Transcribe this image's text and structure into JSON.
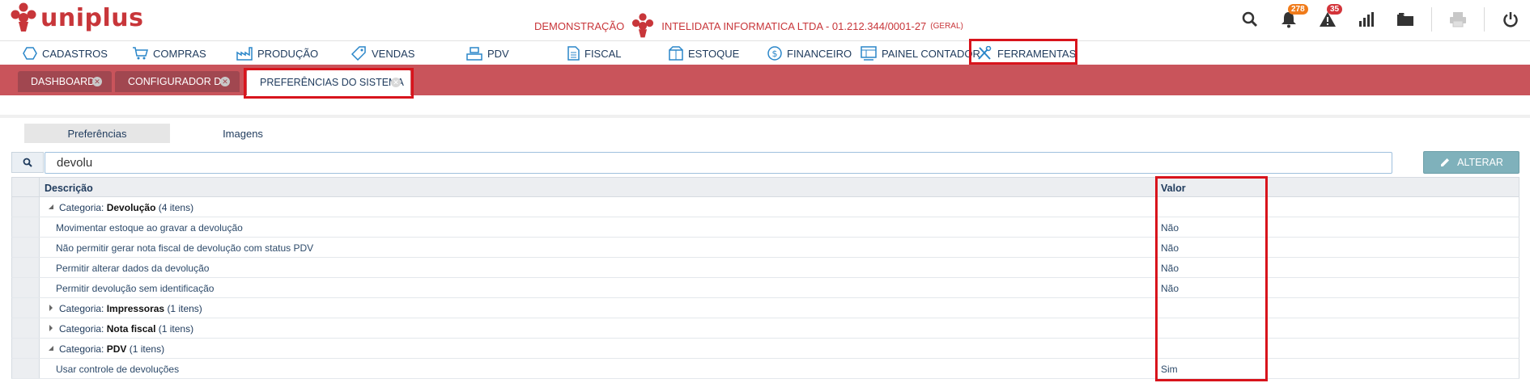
{
  "app": {
    "logo_text": "uniplus"
  },
  "company": {
    "mode": "DEMONSTRAÇÃO",
    "name": "INTELIDATA INFORMATICA LTDA - 01.212.344/0001-27",
    "scope": "(GERAL)"
  },
  "header": {
    "notifications_count": "278",
    "alerts_count": "35"
  },
  "menu": [
    {
      "label": "CADASTROS",
      "icon": "hexagon-icon"
    },
    {
      "label": "COMPRAS",
      "icon": "cart-icon"
    },
    {
      "label": "PRODUÇÃO",
      "icon": "factory-icon"
    },
    {
      "label": "VENDAS",
      "icon": "tag-icon"
    },
    {
      "label": "PDV",
      "icon": "register-icon"
    },
    {
      "label": "FISCAL",
      "icon": "document-icon"
    },
    {
      "label": "ESTOQUE",
      "icon": "box-icon"
    },
    {
      "label": "FINANCEIRO",
      "icon": "dollar-icon"
    },
    {
      "label": "PAINEL CONTADOR",
      "icon": "panel-icon"
    },
    {
      "label": "FERRAMENTAS",
      "icon": "tools-icon"
    }
  ],
  "tabs": [
    {
      "label": "DASHBOARD"
    },
    {
      "label": "CONFIGURADOR D..."
    },
    {
      "label": "PREFERÊNCIAS DO SISTEMA"
    }
  ],
  "subtabs": [
    {
      "label": "Preferências"
    },
    {
      "label": "Imagens"
    }
  ],
  "search": {
    "value": "devolu"
  },
  "alter_button": {
    "label": "ALTERAR"
  },
  "grid": {
    "columns": {
      "description": "Descrição",
      "value": "Valor"
    },
    "groups": [
      {
        "prefix": "Categoria:",
        "name": "Devolução",
        "count": "(4 itens)",
        "expanded": true,
        "items": [
          {
            "description": "Movimentar estoque ao gravar a devolução",
            "value": "Não"
          },
          {
            "description": "Não permitir gerar nota fiscal de devolução com status PDV",
            "value": "Não"
          },
          {
            "description": "Permitir alterar dados da devolução",
            "value": "Não"
          },
          {
            "description": "Permitir devolução sem identificação",
            "value": "Não"
          }
        ]
      },
      {
        "prefix": "Categoria:",
        "name": "Impressoras",
        "count": "(1 itens)",
        "expanded": false,
        "items": []
      },
      {
        "prefix": "Categoria:",
        "name": "Nota fiscal",
        "count": "(1 itens)",
        "expanded": false,
        "items": []
      },
      {
        "prefix": "Categoria:",
        "name": "PDV",
        "count": "(1 itens)",
        "expanded": true,
        "items": [
          {
            "description": "Usar controle de devoluções",
            "value": "Sim"
          }
        ]
      }
    ]
  },
  "colors": {
    "brand_red": "#c8363a",
    "tabstrip": "#c9545b",
    "highlight": "#d8141c",
    "text_navy": "#1e3a5c",
    "alter_button": "#7fb1bb"
  }
}
